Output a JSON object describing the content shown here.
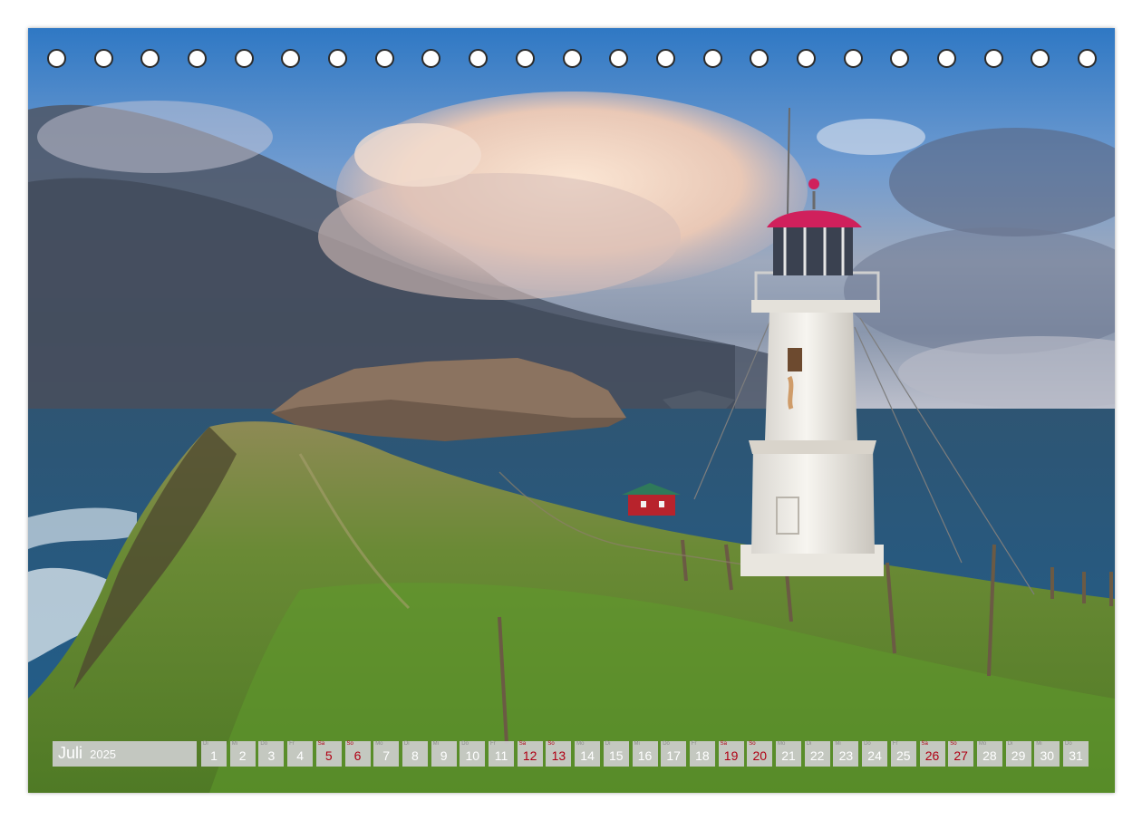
{
  "calendar": {
    "month": "Juli",
    "year": "2025",
    "accent_weekend": "#b00014",
    "days": [
      {
        "num": "1",
        "dow": "Di",
        "weekend": false
      },
      {
        "num": "2",
        "dow": "Mi",
        "weekend": false
      },
      {
        "num": "3",
        "dow": "Do",
        "weekend": false
      },
      {
        "num": "4",
        "dow": "Fr",
        "weekend": false
      },
      {
        "num": "5",
        "dow": "Sa",
        "weekend": true
      },
      {
        "num": "6",
        "dow": "So",
        "weekend": true
      },
      {
        "num": "7",
        "dow": "Mo",
        "weekend": false
      },
      {
        "num": "8",
        "dow": "Di",
        "weekend": false
      },
      {
        "num": "9",
        "dow": "Mi",
        "weekend": false
      },
      {
        "num": "10",
        "dow": "Do",
        "weekend": false
      },
      {
        "num": "11",
        "dow": "Fr",
        "weekend": false
      },
      {
        "num": "12",
        "dow": "Sa",
        "weekend": true
      },
      {
        "num": "13",
        "dow": "So",
        "weekend": true
      },
      {
        "num": "14",
        "dow": "Mo",
        "weekend": false
      },
      {
        "num": "15",
        "dow": "Di",
        "weekend": false
      },
      {
        "num": "16",
        "dow": "Mi",
        "weekend": false
      },
      {
        "num": "17",
        "dow": "Do",
        "weekend": false
      },
      {
        "num": "18",
        "dow": "Fr",
        "weekend": false
      },
      {
        "num": "19",
        "dow": "Sa",
        "weekend": true
      },
      {
        "num": "20",
        "dow": "So",
        "weekend": true
      },
      {
        "num": "21",
        "dow": "Mo",
        "weekend": false
      },
      {
        "num": "22",
        "dow": "Di",
        "weekend": false
      },
      {
        "num": "23",
        "dow": "Mi",
        "weekend": false
      },
      {
        "num": "24",
        "dow": "Do",
        "weekend": false
      },
      {
        "num": "25",
        "dow": "Fr",
        "weekend": false
      },
      {
        "num": "26",
        "dow": "Sa",
        "weekend": true
      },
      {
        "num": "27",
        "dow": "So",
        "weekend": true
      },
      {
        "num": "28",
        "dow": "Mo",
        "weekend": false
      },
      {
        "num": "29",
        "dow": "Di",
        "weekend": false
      },
      {
        "num": "30",
        "dow": "Mi",
        "weekend": false
      },
      {
        "num": "31",
        "dow": "Do",
        "weekend": false
      }
    ]
  },
  "binding_holes": 23,
  "scene": {
    "sky_top": "#2f78c4",
    "cloud_warm": "#f6ddc8",
    "storm_gray": "#4d5566",
    "sea": "#2b5c84",
    "grass": "#5f8a2e",
    "lighthouse": "#f1eee8",
    "lantern_roof": "#d0205c",
    "cottage_roof": "#2f7a5a",
    "cottage_wall": "#b8232c"
  }
}
